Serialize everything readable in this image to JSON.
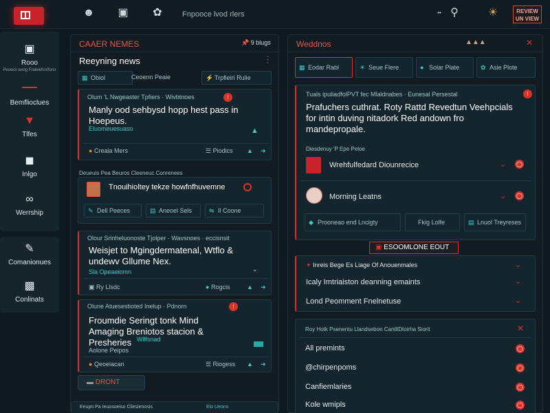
{
  "topbar": {
    "title": "Fnpooce lvod rlers",
    "badge_line1": "REVIEW",
    "badge_line2": "UN VIEW"
  },
  "sidebar": {
    "items": [
      {
        "label": "Rooo",
        "sub": "Peowoi uvolg Fraleiefsn/forsr",
        "icon": "inbox-icon"
      },
      {
        "label": "Bemflioclues",
        "icon": ""
      },
      {
        "label": "Tlfes",
        "icon": "pin-icon"
      },
      {
        "label": "Inlgo",
        "icon": "camera-icon"
      },
      {
        "label": "Werrship",
        "icon": "link-icon"
      },
      {
        "label": "Comanionues",
        "icon": "chat-icon"
      },
      {
        "label": "Conlinats",
        "icon": "id-icon"
      }
    ]
  },
  "left": {
    "header": "CAAER NEMES",
    "header_right": "9 blugs",
    "section_title": "Reeyning news",
    "filters": [
      "Obiol",
      "Ceoenn Peaie",
      "Trpfieiri Rulie"
    ],
    "card1": {
      "kicker": "Olum 'L Nwgeaster Tpfiers · Wivbtnoes",
      "headline": "Manly ood sehbysd hopp hest pass in Hoepeus.",
      "tag": "Eluomeuesuaso",
      "source": "Creaia Mers",
      "count": "Piodics"
    },
    "section2": "Deueuis Pea Beuros Cleeneuc Conrenees",
    "card2": {
      "text": "Tnouihioltey tekze howfnfhuvemne",
      "buttons": [
        "Dell Peeces",
        "Aneoel Sels",
        "Il Coone"
      ]
    },
    "card3": {
      "kicker": "Olour Srinheluonoste Tjolper · Wavsnoes · eccisnsit",
      "headline": "Weisjet to Mgingdermatenal, Wtflo & undewv Gllume Nex.",
      "source": "Sla Opeaeiomn",
      "foot_left": "Ry Llsdc",
      "foot_right": "Rogcis"
    },
    "card4": {
      "kicker": "Olune Atuesestioted Inelup · Pdnorn",
      "headline": "Froumdie Seringt tonk Mind Amaging Breniotos stacion & Presheries",
      "tag": "Wllfsnad",
      "tag2": "Aolone Peipos",
      "source": "Qeoeiacan",
      "count": "Riogess"
    },
    "button": "DRONT",
    "footer_left": "Eeupn Pa Ieuosoeiso Cliesienosis",
    "footer_right": "Elo Ueons"
  },
  "right": {
    "header": "Weddnos",
    "tabs": [
      "Eodar Rabl",
      "Seue Flere",
      "Solar Plate",
      "Asie Plote"
    ],
    "feature": {
      "kicker": "Tuals ipuliadfolPVT fec Mlaldnabes · Eunesal Persestal",
      "headline": "Prafuchers cuthrat. Roty Rattd Revedtun Veehpcials for intin duving nitadork Red andown fro mandepropale."
    },
    "sub_kicker": "Diesdenuy 'P Epe Peloe",
    "rows": [
      "Wrehfulfedard Diounrecice",
      "Morning Leatns"
    ],
    "mini_buttons": [
      "Prooneao end Lncigty",
      "Fkig Lolfe",
      "Lnuol Treyreses"
    ],
    "section_button": "ESOOMLONE EOUT",
    "list1": [
      "Inreis Bege Es Liage Of Anouenmales",
      "Icaly Imtriaiston deanning emaints",
      "Lond Peomment Fnelnetuse"
    ],
    "list2_header": "Roy Hotk Psenentu  Llandsebon CantllDtoirha Siorit",
    "list2": [
      "All premints",
      "@chirpenpoms",
      "Canfiemlaries",
      "Kole wmipls"
    ]
  }
}
